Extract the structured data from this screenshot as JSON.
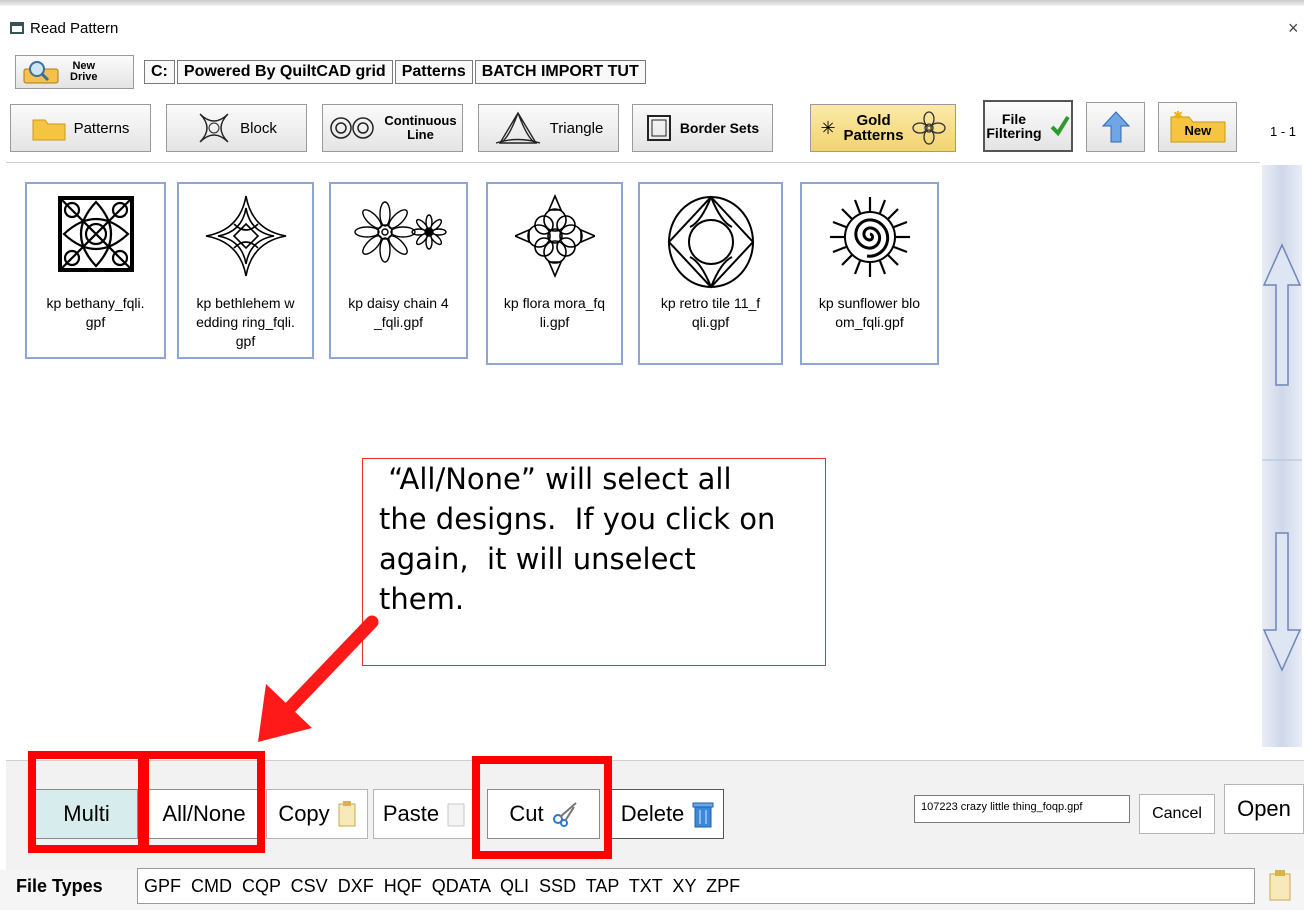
{
  "window": {
    "title": "Read Pattern",
    "close_glyph": "×"
  },
  "drive": {
    "new_drive_label_1": "New",
    "new_drive_label_2": "Drive"
  },
  "path": [
    "C:",
    "Powered By QuiltCAD grid",
    "Patterns",
    "BATCH IMPORT TUT"
  ],
  "toolbar": {
    "patterns": "Patterns",
    "block": "Block",
    "continuous_1": "Continuous",
    "continuous_2": "Line",
    "triangle": "Triangle",
    "border_sets": "Border Sets",
    "gold_1": "Gold",
    "gold_2": "Patterns",
    "file_filtering_1": "File",
    "file_filtering_2": "Filtering",
    "new": "New",
    "page_indicator": "1 - 1"
  },
  "files": [
    {
      "name": "kp bethany_fqli.gpf",
      "line1": "kp bethany_fqli.",
      "line2": "gpf",
      "line3": "",
      "icon": "square-lattice-pattern-icon"
    },
    {
      "name": "kp bethlehem wedding ring_fqli.gpf",
      "line1": "kp bethlehem w",
      "line2": "edding ring_fqli.",
      "line3": "gpf",
      "icon": "four-point-star-pattern-icon"
    },
    {
      "name": "kp daisy chain 4_fqli.gpf",
      "line1": "kp daisy chain 4",
      "line2": "_fqli.gpf",
      "line3": "",
      "icon": "daisy-pattern-icon"
    },
    {
      "name": "kp flora mora_fqli.gpf",
      "line1": "kp flora mora_fq",
      "line2": "li.gpf",
      "line3": "",
      "icon": "flower-medallion-pattern-icon"
    },
    {
      "name": "kp retro tile 11_fqli.gpf",
      "line1": "kp retro tile 11_f",
      "line2": "qli.gpf",
      "line3": "",
      "icon": "retro-tile-pattern-icon"
    },
    {
      "name": "kp sunflower bloom_fqli.gpf",
      "line1": "kp sunflower blo",
      "line2": "om_fqli.gpf",
      "line3": "",
      "icon": "sunflower-pattern-icon"
    }
  ],
  "callout": {
    "line1": " “All/None” will select all",
    "line2": "the designs.  If you click on",
    "line3": "again,  it will unselect",
    "line4": "them."
  },
  "actions": {
    "multi": "Multi",
    "all_none": "All/None",
    "copy": "Copy",
    "paste": "Paste",
    "cut": "Cut",
    "delete": "Delete",
    "selected_file": "107223 crazy little thing_foqp.gpf",
    "cancel": "Cancel",
    "open": "Open"
  },
  "file_types": {
    "label": "File Types",
    "list": "GPF  CMD  CQP  CSV  DXF  HQF  QDATA  QLI  SSD  TAP  TXT  XY  ZPF"
  },
  "colors": {
    "highlight_red": "#ff0000",
    "thumb_border": "#8ea5d6",
    "gold": "#f6df8c"
  }
}
